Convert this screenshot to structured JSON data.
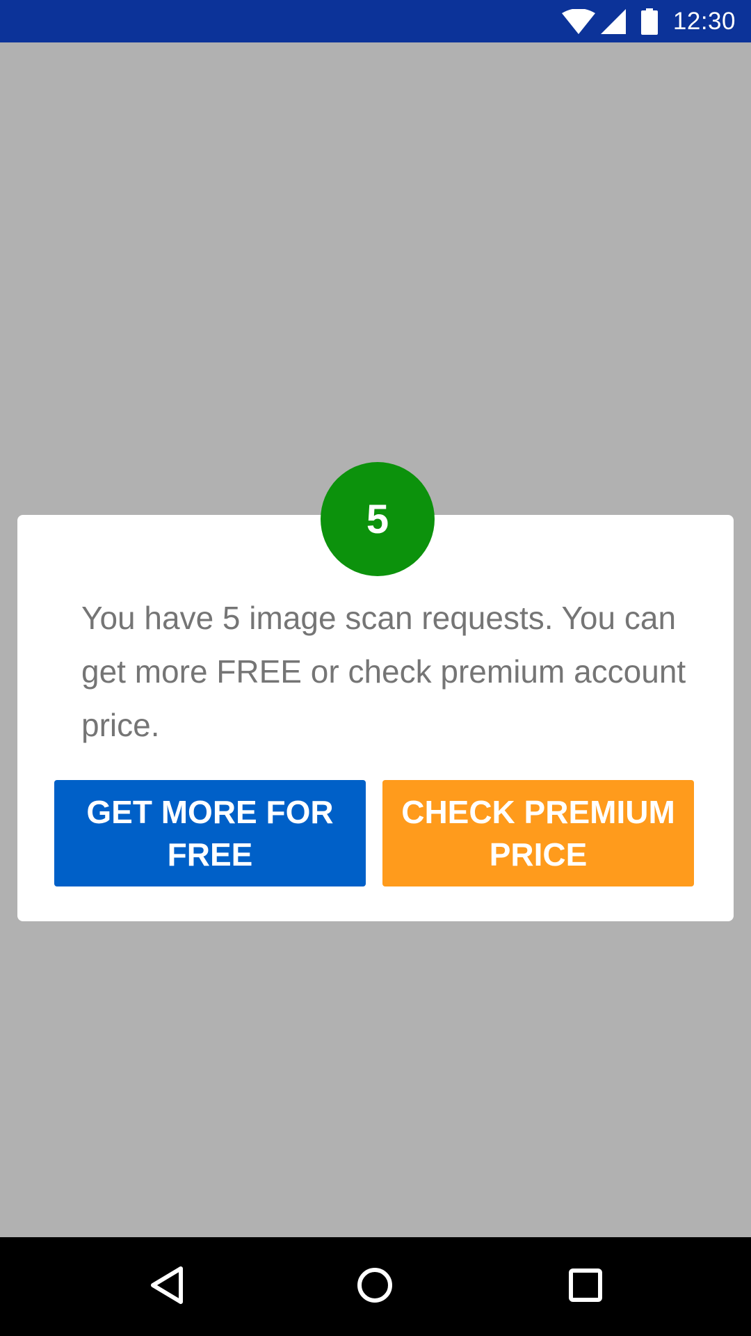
{
  "status_bar": {
    "time": "12:30",
    "icons": [
      "wifi-icon",
      "signal-icon",
      "battery-icon"
    ],
    "background": "#0c3399"
  },
  "dialog": {
    "badge_count": "5",
    "badge_color": "#0c920c",
    "message": "You have 5 image scan requests. You can get more FREE or check premium account price.",
    "buttons": {
      "free_label": "GET MORE FOR FREE",
      "free_color": "#0060c8",
      "premium_label": "CHECK PREMIUM PRICE",
      "premium_color": "#ff9b1c"
    }
  },
  "nav_bar": {
    "icons": [
      "back-icon",
      "home-icon",
      "recents-icon"
    ]
  }
}
